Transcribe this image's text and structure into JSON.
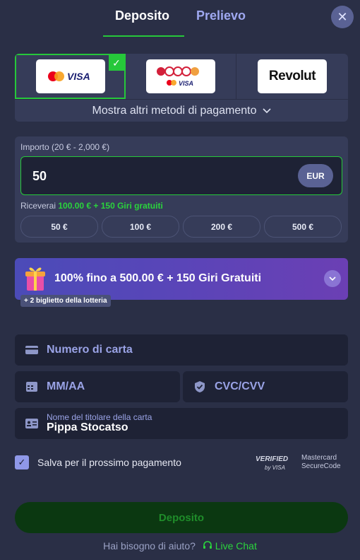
{
  "tabs": {
    "deposit": "Deposito",
    "withdraw": "Prelievo"
  },
  "close_symbol": "✕",
  "payment": {
    "methods": [
      {
        "name": "Mastercard / Visa",
        "logo_text": "VISA"
      },
      {
        "name": "Cards multi",
        "logo_text": "VISA"
      },
      {
        "name": "Revolut",
        "logo_text": "Revolut"
      }
    ],
    "selected_check": "✓",
    "more_methods": "Mostra altri metodi di pagamento"
  },
  "amount": {
    "label": "Importo (20 € - 2,000 €)",
    "value": "50",
    "currency": "EUR",
    "receive_prefix": "Riceverai",
    "receive_value": "100.00 € + 150 Giri gratuiti",
    "quick_amounts": [
      "50 €",
      "100 €",
      "200 €",
      "500 €"
    ]
  },
  "bonus": {
    "text": "100% fino a 500.00 € + 150 Giri Gratuiti",
    "lottery": "+ 2 biglietto della lotteria"
  },
  "form": {
    "card_number_placeholder": "Numero di carta",
    "expiry_placeholder": "MM/AA",
    "cvc_placeholder": "CVC/CVV",
    "holder_label": "Nome del titolare della carta",
    "holder_value": "Pippa Stocatso"
  },
  "save": {
    "checked": true,
    "label": "Salva per il prossimo pagamento"
  },
  "security": {
    "verified_line1": "VERIFIED",
    "verified_line2": "by VISA",
    "mc_line1": "Mastercard",
    "mc_line2": "SecureCode"
  },
  "deposit_button": "Deposito",
  "help": {
    "question": "Hai bisogno di aiuto?",
    "live_chat": "Live Chat"
  },
  "colors": {
    "accent_green": "#26c83a",
    "background": "#2a2f46",
    "panel": "#363c59",
    "field": "#1e2235",
    "link_blue": "#9fa8f0"
  }
}
